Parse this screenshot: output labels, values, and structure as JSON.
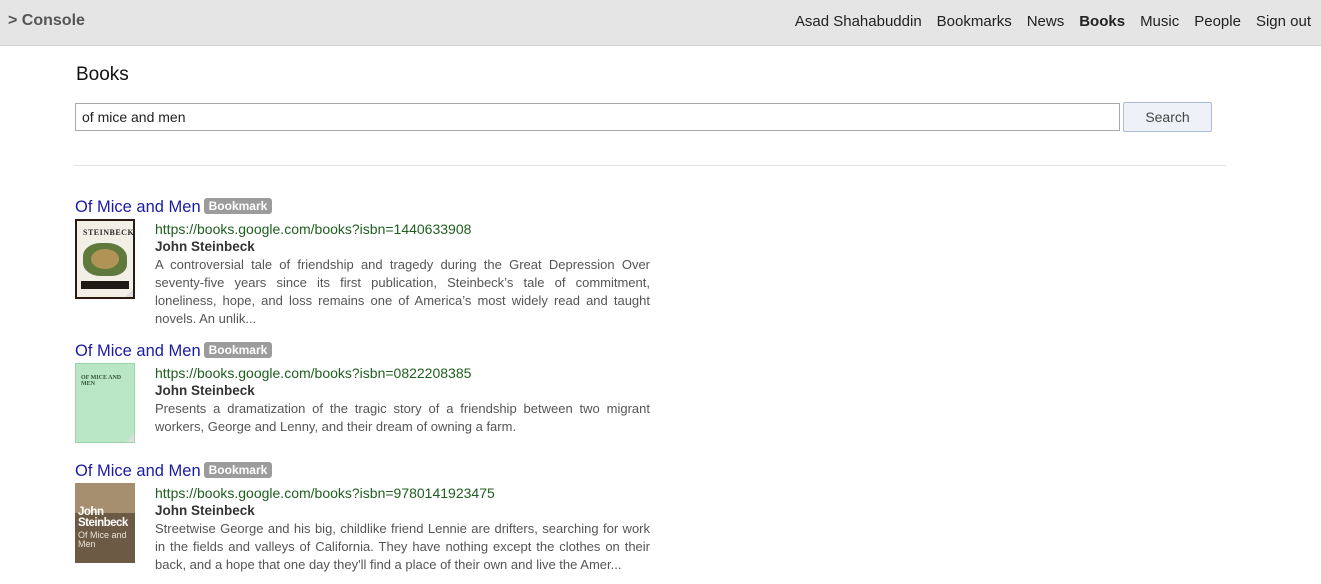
{
  "header": {
    "brand": "> Console",
    "nav": [
      {
        "label": "Asad Shahabuddin",
        "active": false
      },
      {
        "label": "Bookmarks",
        "active": false
      },
      {
        "label": "News",
        "active": false
      },
      {
        "label": "Books",
        "active": true
      },
      {
        "label": "Music",
        "active": false
      },
      {
        "label": "People",
        "active": false
      },
      {
        "label": "Sign out",
        "active": false
      }
    ]
  },
  "page": {
    "title": "Books"
  },
  "search": {
    "value": "of mice and men",
    "button_label": "Search"
  },
  "results": [
    {
      "title": "Of Mice and Men",
      "badge": "Bookmark",
      "url": "https://books.google.com/books?isbn=1440633908",
      "author": "John Steinbeck",
      "description": "A controversial tale of friendship and tragedy during the Great Depression Over seventy-five years since its first publication, Steinbeck’s tale of commitment, loneliness, hope, and loss remains one of America’s most widely read and taught novels. An unlik...",
      "cover_text": "STEINBECK"
    },
    {
      "title": "Of Mice and Men",
      "badge": "Bookmark",
      "url": "https://books.google.com/books?isbn=0822208385",
      "author": "John Steinbeck",
      "description": "Presents a dramatization of the tragic story of a friendship between two migrant workers, George and Lenny, and their dream of owning a farm.",
      "cover_text": "OF MICE AND MEN"
    },
    {
      "title": "Of Mice and Men",
      "badge": "Bookmark",
      "url": "https://books.google.com/books?isbn=9780141923475",
      "author": "John Steinbeck",
      "description": "Streetwise George and his big, childlike friend Lennie are drifters, searching for work in the fields and valleys of California. They have nothing except the clothes on their back, and a hope that one day they'll find a place of their own and live the Amer...",
      "cover_text": "John Steinbeck",
      "cover_subtext": "Of Mice and Men"
    }
  ]
}
